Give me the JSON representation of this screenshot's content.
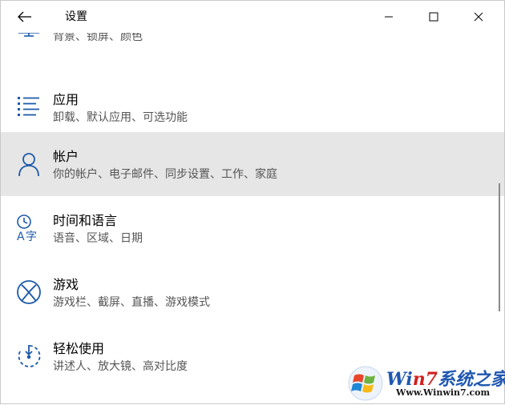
{
  "window": {
    "title": "设置"
  },
  "items": [
    {
      "title": "",
      "desc": "背景、锁屏、颜色",
      "icon": "personalization-icon"
    },
    {
      "title": "应用",
      "desc": "卸载、默认应用、可选功能",
      "icon": "apps-list-icon"
    },
    {
      "title": "帐户",
      "desc": "你的帐户、电子邮件、同步设置、工作、家庭",
      "icon": "person-icon"
    },
    {
      "title": "时间和语言",
      "desc": "语音、区域、日期",
      "icon": "time-language-icon"
    },
    {
      "title": "游戏",
      "desc": "游戏栏、截屏、直播、游戏模式",
      "icon": "xbox-icon"
    },
    {
      "title": "轻松使用",
      "desc": "讲述人、放大镜、高对比度",
      "icon": "ease-of-access-icon"
    }
  ],
  "selected_index": 2,
  "watermark": {
    "brand_part1": "Wi",
    "brand_part2": "n7",
    "brand_part3": "系统之家",
    "url": "Www.Winwin7.com"
  },
  "colors": {
    "accent": "#2b6cb0",
    "selected_bg": "#e6e6e6",
    "icon": "#1e5aa8"
  }
}
